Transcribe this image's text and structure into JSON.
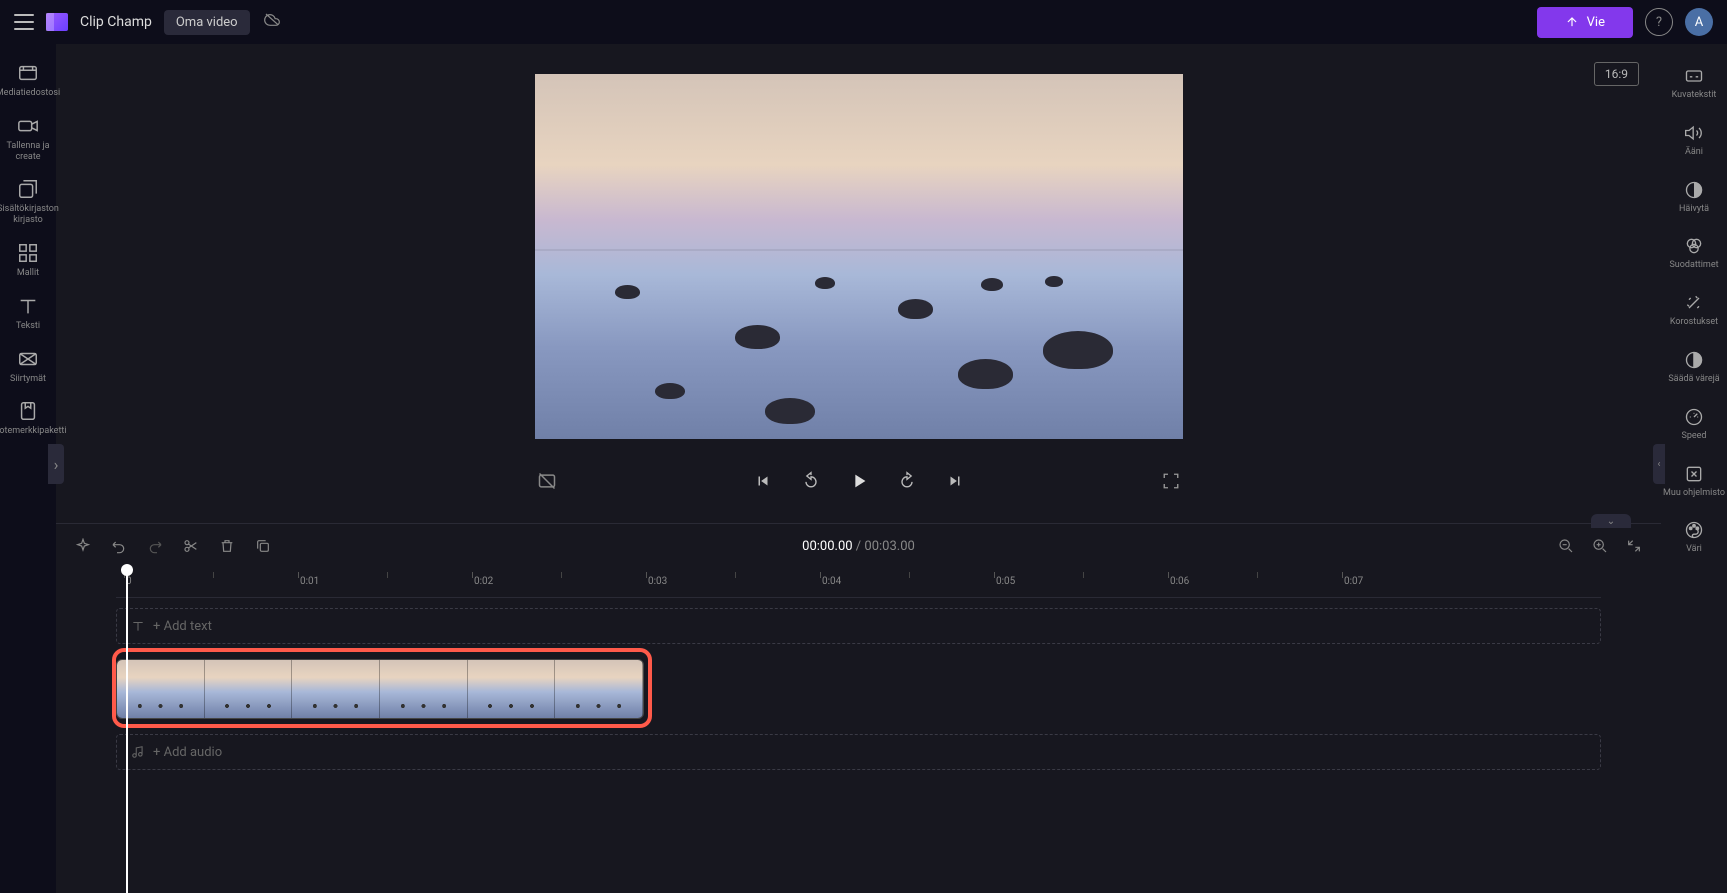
{
  "header": {
    "brand": "Clip Champ",
    "video_name": "Oma video",
    "export_label": "Vie",
    "avatar_initial": "A"
  },
  "left_sidebar": {
    "items": [
      {
        "id": "media",
        "label": "Mediatiedostosi"
      },
      {
        "id": "record",
        "label": "Tallenna ja create"
      },
      {
        "id": "library",
        "label": "Sisältökirjaston kirjasto"
      },
      {
        "id": "templates",
        "label": "Mallit"
      },
      {
        "id": "text",
        "label": "Teksti"
      },
      {
        "id": "transitions",
        "label": "Siirtymät"
      },
      {
        "id": "brandkit",
        "label": "Tuotemerkkipaketti"
      }
    ]
  },
  "right_sidebar": {
    "items": [
      {
        "id": "captions",
        "label": "Kuvatekstit"
      },
      {
        "id": "audio",
        "label": "Ääni"
      },
      {
        "id": "fade",
        "label": "Häivytä"
      },
      {
        "id": "filters",
        "label": "Suodattimet"
      },
      {
        "id": "effects",
        "label": "Korostukset"
      },
      {
        "id": "color-adjust",
        "label": "Säädä värejä"
      },
      {
        "id": "speed",
        "label": "Speed"
      },
      {
        "id": "plugins",
        "label": "Muu ohjelmisto"
      },
      {
        "id": "color",
        "label": "Väri"
      }
    ]
  },
  "preview": {
    "aspect_ratio": "16:9"
  },
  "timeline": {
    "time_current": "00:00.00",
    "time_separator": " / ",
    "time_total": "00:03.00",
    "ruler_marks": [
      "0",
      "0:01",
      "0:02",
      "0:03",
      "0:04",
      "0:05",
      "0:06",
      "0:07"
    ],
    "add_text_label": "+ Add text",
    "add_audio_label": "+ Add audio"
  }
}
